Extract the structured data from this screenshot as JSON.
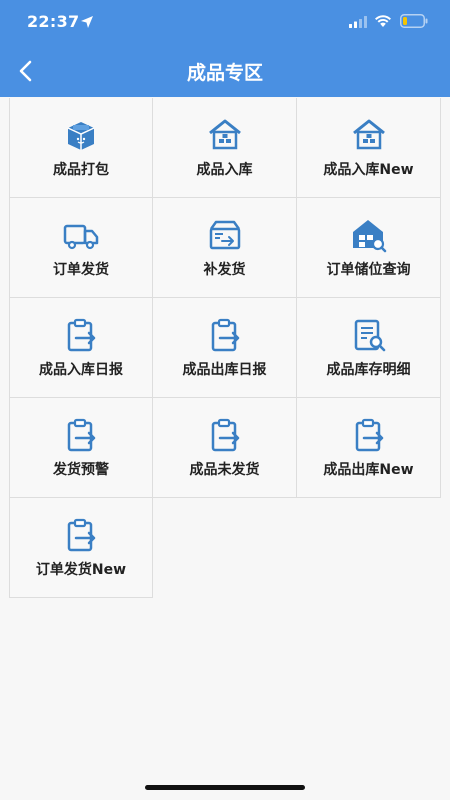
{
  "status_bar": {
    "time": "22:37"
  },
  "header": {
    "title": "成品专区",
    "back_icon": "chevron-left-icon"
  },
  "colors": {
    "header_bg": "#4a90e2",
    "icon_blue": "#3a7fc4",
    "page_bg": "#f7f7f7"
  },
  "menu": {
    "items": [
      {
        "label": "成品打包",
        "icon": "package-box-icon"
      },
      {
        "label": "成品入库",
        "icon": "warehouse-icon"
      },
      {
        "label": "成品入库New",
        "icon": "warehouse-icon"
      },
      {
        "label": "订单发货",
        "icon": "truck-icon"
      },
      {
        "label": "补发货",
        "icon": "open-box-arrow-icon"
      },
      {
        "label": "订单储位查询",
        "icon": "warehouse-search-icon"
      },
      {
        "label": "成品入库日报",
        "icon": "clipboard-arrow-icon"
      },
      {
        "label": "成品出库日报",
        "icon": "clipboard-arrow-icon"
      },
      {
        "label": "成品库存明细",
        "icon": "document-search-icon"
      },
      {
        "label": "发货预警",
        "icon": "clipboard-arrow-icon"
      },
      {
        "label": "成品未发货",
        "icon": "clipboard-arrow-icon"
      },
      {
        "label": "成品出库New",
        "icon": "clipboard-arrow-icon"
      },
      {
        "label": "订单发货New",
        "icon": "clipboard-arrow-icon"
      }
    ]
  }
}
